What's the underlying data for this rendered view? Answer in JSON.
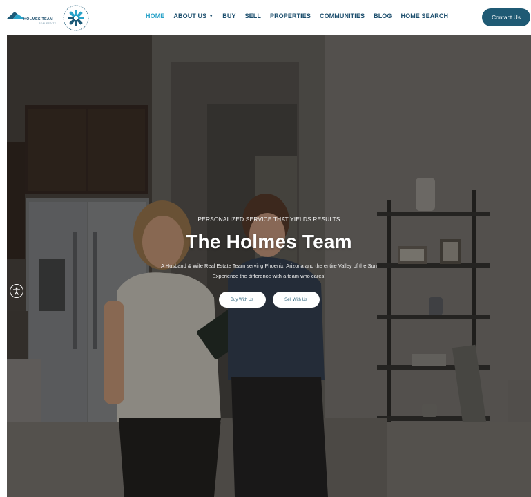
{
  "header": {
    "logo_name": "HOLMES TEAM",
    "logo_sub": "REAL ESTATE",
    "nav": [
      {
        "label": "HOME",
        "active": true
      },
      {
        "label": "ABOUT US",
        "dropdown": true
      },
      {
        "label": "BUY"
      },
      {
        "label": "SELL"
      },
      {
        "label": "PROPERTIES"
      },
      {
        "label": "COMMUNITIES"
      },
      {
        "label": "BLOG"
      },
      {
        "label": "HOME SEARCH"
      }
    ],
    "contact_label": "Contact Us"
  },
  "hero": {
    "eyebrow": "PERSONALIZED SERVICE THAT YIELDS RESULTS",
    "title": "The Holmes Team",
    "description_line1": "A Husband & Wife Real Estate Team serving Phoenix, Arizona and the entire Valley of the Sun",
    "description_line2": "Experience the difference with a team who cares!",
    "buy_label": "Buy With Us",
    "sell_label": "Sell With Us"
  },
  "colors": {
    "brand_dark": "#1f5a74",
    "nav_text": "#1d4f6e",
    "nav_active": "#2aa3c9"
  }
}
